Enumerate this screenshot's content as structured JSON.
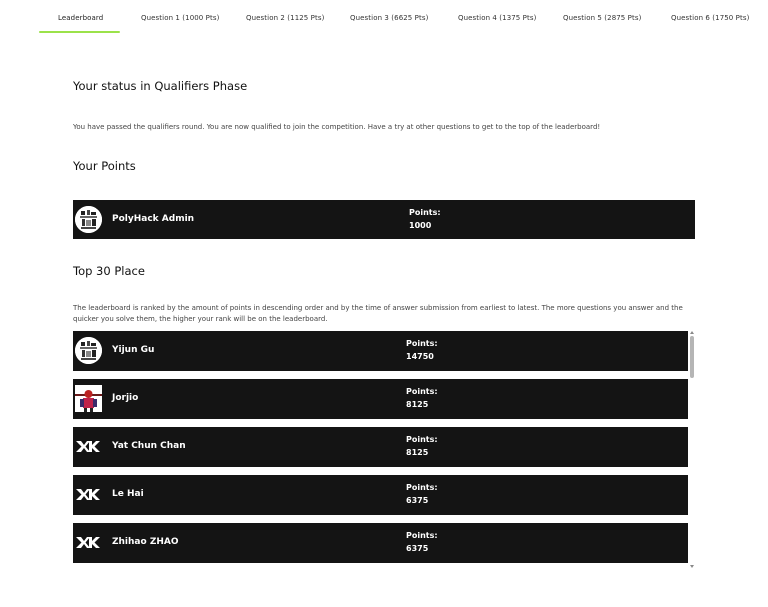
{
  "tabs": [
    {
      "label": "Leaderboard"
    },
    {
      "label": "Question 1 (1000 Pts)"
    },
    {
      "label": "Question 2 (1125 Pts)"
    },
    {
      "label": "Question 3 (6625 Pts)"
    },
    {
      "label": "Question 4 (1375 Pts)"
    },
    {
      "label": "Question 5 (2875 Pts)"
    },
    {
      "label": "Question 6 (1750 Pts)"
    }
  ],
  "status": {
    "title": "Your status in Qualifiers Phase",
    "message": "You have passed the qualifiers round. You are now qualified to join the competition. Have a try at other questions to get to the top of the leaderboard!"
  },
  "your_points": {
    "title": "Your Points",
    "name": "PolyHack Admin",
    "points_label": "Points:",
    "points": "1000"
  },
  "top": {
    "title": "Top 30 Place",
    "description": "The leaderboard is ranked by the amount of points in descending order and by the time of answer submission from earliest to latest. The more questions you answer and the quicker you solve them, the higher your rank will be on the leaderboard.",
    "entries": [
      {
        "name": "Yijun Gu",
        "points_label": "Points:",
        "points": "14750",
        "avatar": "pixel-art-avatar"
      },
      {
        "name": "Jorjio",
        "points_label": "Points:",
        "points": "8125",
        "avatar": "character-avatar"
      },
      {
        "name": "Yat Chun Chan",
        "points_label": "Points:",
        "points": "8125",
        "avatar": "xk-logo-avatar"
      },
      {
        "name": "Le Hai",
        "points_label": "Points:",
        "points": "6375",
        "avatar": "xk-logo-avatar"
      },
      {
        "name": "Zhihao ZHAO",
        "points_label": "Points:",
        "points": "6375",
        "avatar": "xk-logo-avatar"
      }
    ]
  }
}
